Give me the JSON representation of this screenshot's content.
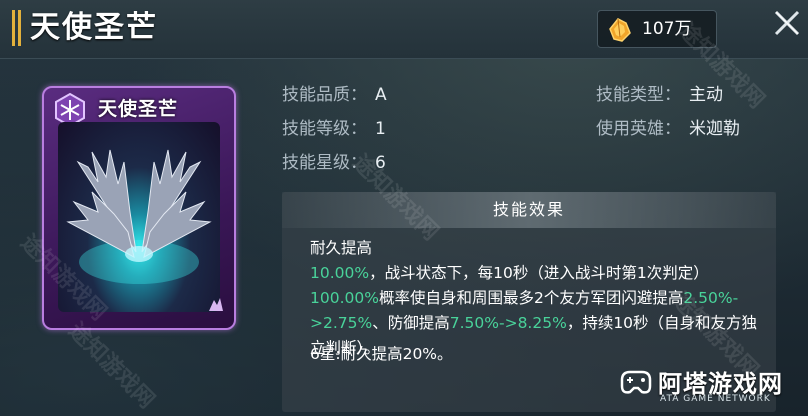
{
  "header": {
    "title": "天使圣芒",
    "currency": {
      "icon": "gold-crystal-icon",
      "value": "107万"
    }
  },
  "card": {
    "title": "天使圣芒",
    "icon": "purple-hex-icon",
    "art": "angel-wings-art",
    "rank_icon": "rank-mark-icon"
  },
  "info": {
    "quality_label": "技能品质：",
    "quality_value": "A",
    "level_label": "技能等级：",
    "level_value": "1",
    "star_label": "技能星级：",
    "star_value": "6",
    "type_label": "技能类型：",
    "type_value": "主动",
    "hero_label": "使用英雄：",
    "hero_value": "米迦勒"
  },
  "effect": {
    "header": "技能效果",
    "seg1": "耐久提高",
    "hl1": "10.00%",
    "seg2": "，战斗状态下，每10秒（进入战斗时第1次判定）",
    "hl2": "100.00%",
    "seg3": "概率使自身和周围最多2个友方军团闪避提高",
    "hl3": "2.50%->2.75%",
    "seg4": "、防御提高",
    "hl4": "7.50%->8.25%",
    "seg5": "，持续10秒（自身和友方独立判断）。",
    "star_line": "6星:耐久提高20%。"
  },
  "watermarks": [
    "途知游戏网",
    "途知游戏网",
    "途知游戏网",
    "途知游戏网",
    "途知游戏网"
  ],
  "brand": {
    "name": "阿塔游戏网",
    "sub": "ATA GAME NETWORK",
    "logo": "gamepad-logo-icon"
  },
  "colors": {
    "highlight": "#49d39a",
    "card_border": "#b97ee0",
    "accent_gold": "#e3b13c"
  }
}
